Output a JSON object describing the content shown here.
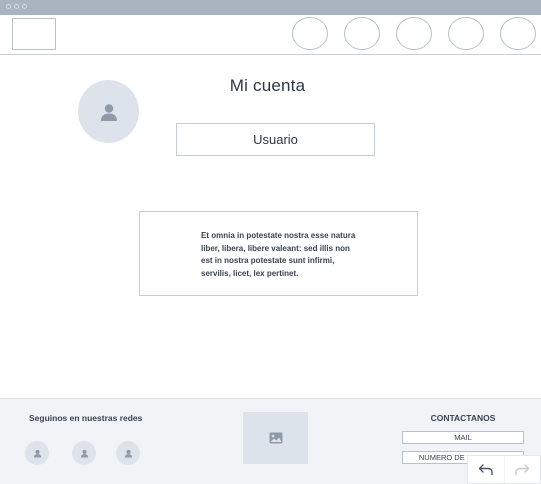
{
  "header": {
    "logo_icon": "logo-placeholder",
    "nav_items": [
      "nav-circle",
      "nav-circle",
      "nav-circle",
      "nav-circle",
      "nav-circle"
    ]
  },
  "main": {
    "title": "Mi cuenta",
    "avatar_icon": "user-icon",
    "username": "Usuario",
    "body_text": "Et omnia in potestate nostra esse natura liber, libera, libere valeant: sed illis non est in nostra potestate sunt infirmi, servilis, licet, lex pertinet."
  },
  "footer": {
    "social_title": "Seguinos en nuestras redes",
    "social_icons": [
      "user-icon",
      "user-icon",
      "user-icon"
    ],
    "image_icon": "image-icon",
    "contact_title": "CONTACTANOS",
    "contact_mail": "MAIL",
    "contact_phone": "NUMERO DE TELEFONO"
  },
  "toolbar": {
    "undo_icon": "undo-icon",
    "redo_icon": "redo-icon"
  },
  "colors": {
    "titlebar": "#a9b4c0",
    "placeholder_fill": "#dde3ea",
    "icon": "#8e9aa8",
    "border": "#c5cdd6",
    "footer_bg": "#f1f4f7"
  }
}
